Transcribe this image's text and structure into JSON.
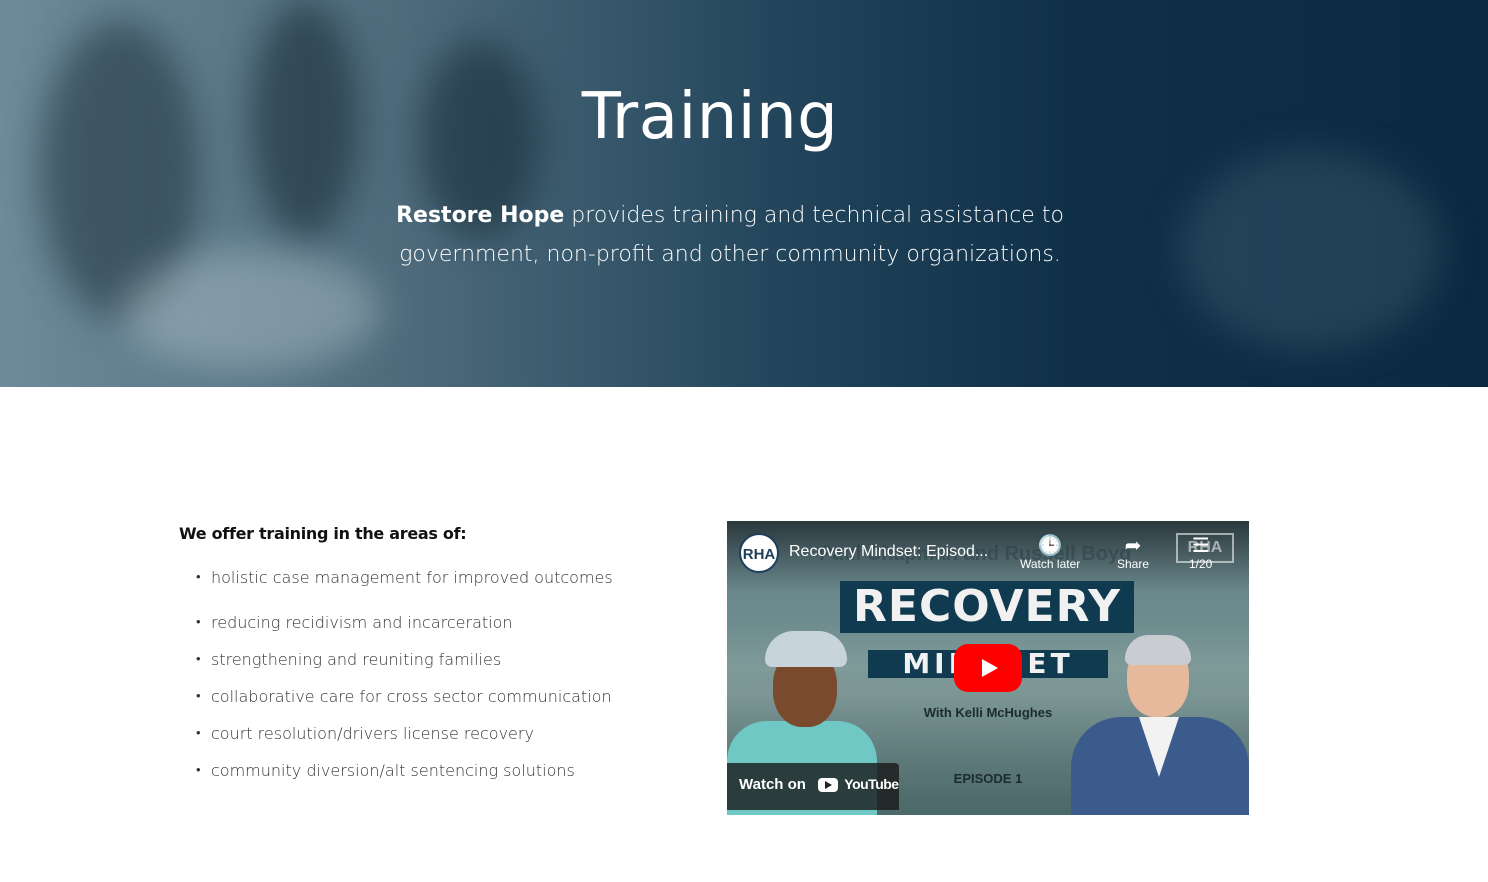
{
  "hero": {
    "title": "Training",
    "text_bold": "Restore Hope",
    "text_rest": " provides training and technical assistance to government, non-profit and other community organizations."
  },
  "content": {
    "heading": "We offer training in the areas of:",
    "items": [
      "holistic case management for improved outcomes",
      "reducing recidivism and incarceration",
      "strengthening and reuniting families",
      "collaborative care for cross sector communication",
      "court resolution/drivers license recovery",
      "community diversion/alt sentencing solutions"
    ]
  },
  "video": {
    "channel_initials": "RHA",
    "title": "Recovery Mindset: Episod...",
    "ghost_title": "Paul Chapman and Russell Boyd",
    "watch_later": "Watch later",
    "share": "Share",
    "playlist_count": "1/20",
    "logo_text": "RHA",
    "thumb_big": "RECOVERY",
    "thumb_sub": "MINDSET",
    "host_line": "With Kelli McHughes",
    "episode": "EPISODE 1",
    "watch_on": "Watch on",
    "youtube_word": "YouTube"
  },
  "colors": {
    "hero_dark": "#0b2a41",
    "youtube_red": "#ff0000"
  }
}
